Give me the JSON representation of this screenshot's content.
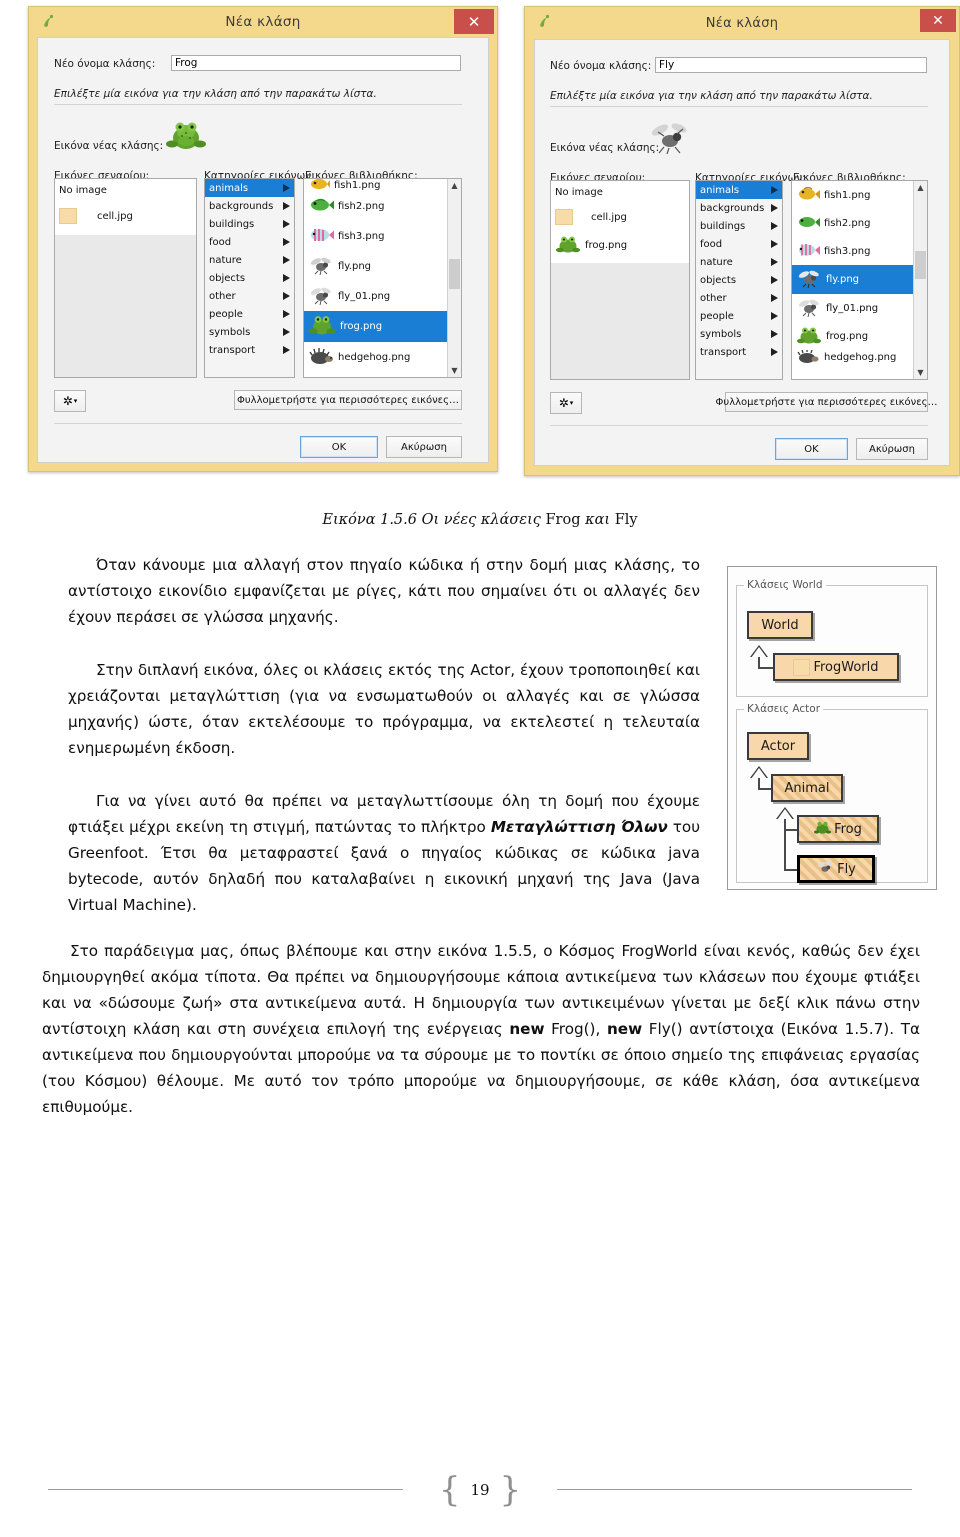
{
  "figure": {
    "dialog_left": {
      "window_title": "Νέα κλάση",
      "app_icon": "greenfoot-icon",
      "close_label": "✕",
      "name_label": "Νέο όνομα κλάσης:",
      "name_value": "Frog",
      "instruction": "Επιλέξτε μία εικόνα για την κλάση από την παρακάτω λίστα.",
      "preview_label": "Εικόνα νέας κλάσης:",
      "preview_icon": "frog-icon",
      "scenario_label": "Εικόνες σεναρίου:",
      "categories_label": "Κατηγορίες εικόνων:",
      "library_label": "Εικόνες βιβλιοθήκης:",
      "scenario_items": [
        {
          "label": "No image",
          "icon": "none"
        },
        {
          "label": "cell.jpg",
          "icon": "cell-thumb"
        }
      ],
      "categories": [
        "animals",
        "backgrounds",
        "buildings",
        "food",
        "nature",
        "objects",
        "other",
        "people",
        "symbols",
        "transport"
      ],
      "selected_category": "animals",
      "library_items": [
        {
          "label": "fish1.png",
          "icon": "fish1-icon",
          "clipped": true
        },
        {
          "label": "fish2.png",
          "icon": "fish2-icon"
        },
        {
          "label": "fish3.png",
          "icon": "fish3-icon"
        },
        {
          "label": "fly.png",
          "icon": "fly-icon"
        },
        {
          "label": "fly_01.png",
          "icon": "fly-icon"
        },
        {
          "label": "frog.png",
          "icon": "frog-icon"
        },
        {
          "label": "hedgehog.png",
          "icon": "hedgehog-icon"
        }
      ],
      "selected_library_item": "frog.png",
      "gear_label": "⚙",
      "browse_label": "Φυλλομετρήστε για περισσότερες εικόνες…",
      "ok_label": "OK",
      "cancel_label": "Ακύρωση"
    },
    "dialog_right": {
      "window_title": "Νέα κλάση",
      "app_icon": "greenfoot-icon",
      "close_label": "✕",
      "name_label": "Νέο όνομα κλάσης:",
      "name_value": "Fly",
      "instruction": "Επιλέξτε μία εικόνα για την κλάση από την παρακάτω λίστα.",
      "preview_label": "Εικόνα νέας κλάσης:",
      "preview_icon": "fly-icon",
      "scenario_label": "Εικόνες σεναρίου:",
      "categories_label": "Κατηγορίες εικόνων:",
      "library_label": "Εικόνες βιβλιοθήκης:",
      "scenario_items": [
        {
          "label": "No image",
          "icon": "none"
        },
        {
          "label": "cell.jpg",
          "icon": "cell-thumb"
        },
        {
          "label": "frog.png",
          "icon": "frog-icon"
        }
      ],
      "categories": [
        "animals",
        "backgrounds",
        "buildings",
        "food",
        "nature",
        "objects",
        "other",
        "people",
        "symbols",
        "transport"
      ],
      "selected_category": "animals",
      "library_items": [
        {
          "label": "fish1.png",
          "icon": "fish1-icon"
        },
        {
          "label": "fish2.png",
          "icon": "fish2-icon"
        },
        {
          "label": "fish3.png",
          "icon": "fish3-icon"
        },
        {
          "label": "fly.png",
          "icon": "fly-icon"
        },
        {
          "label": "fly_01.png",
          "icon": "fly-icon"
        },
        {
          "label": "frog.png",
          "icon": "frog-icon"
        },
        {
          "label": "hedgehog.png",
          "icon": "hedgehog-icon",
          "clipped": true
        }
      ],
      "selected_library_item": "fly.png",
      "gear_label": "⚙",
      "browse_label": "Φυλλομετρήστε για περισσότερες εικόνες…",
      "ok_label": "OK",
      "cancel_label": "Ακύρωση"
    }
  },
  "caption": {
    "number": "Εικόνα 1.5.6 ",
    "title_it": "Οι νέες κλάσεις ",
    "name1": "Frog ",
    "kai": "και ",
    "name2": "Fly"
  },
  "paragraphs": {
    "p1": "Όταν κάνουμε μια αλλαγή στον πηγαίο κώδικα ή στην δομή μιας κλάσης, το αντίστοιχο εικονίδιο εμφανίζεται με ρίγες, κάτι που σημαίνει ότι οι αλλαγές δεν έχουν περάσει σε γλώσσα μηχανής.",
    "p2": "Στην διπλανή εικόνα, όλες οι κλάσεις εκτός της Actor, έχουν τροποποιηθεί και χρειάζονται μεταγλώττιση (για να ενσωματωθούν οι αλλαγές και σε γλώσσα μηχανής) ώστε, όταν εκτελέσουμε το πρόγραμμα, να εκτελεστεί η τελευταία ενημερωμένη έκδοση.",
    "p3_a": "Για να γίνει αυτό θα πρέπει να μεταγλωττίσουμε όλη τη δομή που έχουμε φτιάξει μέχρι εκείνη τη στιγμή, πατώντας το πλήκτρο ",
    "p3_it": "Μεταγλώττιση Όλων",
    "p3_b": " του Greenfoot. Έτσι θα μεταφραστεί ξανά ο πηγαίος κώδικας σε κώδικα java bytecode, αυτόν δηλαδή που καταλαβαίνει η εικονική μηχανή της Java (Java Virtual Machine).",
    "p4_a": "Στο παράδειγμα μας, όπως βλέπουμε και στην εικόνα 1.5.5, ο Κόσμος FrogWorld είναι κενός, καθώς δεν έχει δημιουργηθεί ακόμα τίποτα. Θα πρέπει να δημιουργήσουμε κάποια αντικείμενα των κλάσεων που έχουμε φτιάξει και να «δώσουμε ζωή» στα αντικείμενα αυτά. Η δημιουργία των αντικειμένων γίνεται με δεξί κλικ πάνω στην αντίστοιχη κλάση και στη συνέχεια επιλογή της ενέργειας ",
    "p4_new1": "new",
    "p4_mid1": " Frog(), ",
    "p4_new2": "new",
    "p4_mid2": " Fly() αντίστοιχα (Εικόνα 1.5.7). Τα αντικείμενα που δημιουργούνται μπορούμε να τα σύρουμε με το ποντίκι σε όποιο σημείο της επιφάνειας εργασίας (του Κόσμου) θέλουμε. Με αυτό τον τρόπο μπορούμε να δημιουργήσουμε, σε κάθε κλάση, όσα αντικείμενα επιθυμούμε."
  },
  "class_diagram": {
    "world_group_label": "Κλάσεις World",
    "actor_group_label": "Κλάσεις Actor",
    "world_classes": [
      {
        "name": "World",
        "striped": false,
        "selected": false,
        "icon": "none"
      },
      {
        "name": "FrogWorld",
        "striped": false,
        "selected": false,
        "icon": "world-thumb"
      }
    ],
    "actor_classes": [
      {
        "name": "Actor",
        "striped": false,
        "selected": false,
        "icon": "none"
      },
      {
        "name": "Animal",
        "striped": true,
        "selected": false,
        "icon": "none"
      },
      {
        "name": "Frog",
        "striped": true,
        "selected": false,
        "icon": "frog-icon"
      },
      {
        "name": "Fly",
        "striped": true,
        "selected": true,
        "icon": "fly-icon"
      }
    ]
  },
  "footer": {
    "page_number": "19",
    "brace_left": "{",
    "brace_right": "}"
  },
  "colors": {
    "dialog_frame": "#f4d98c",
    "close_button": "#c94f4a",
    "selection_blue": "#1a7fd4",
    "class_box_fill": "#f8d8ab",
    "class_box_border": "#3a3a3a"
  }
}
